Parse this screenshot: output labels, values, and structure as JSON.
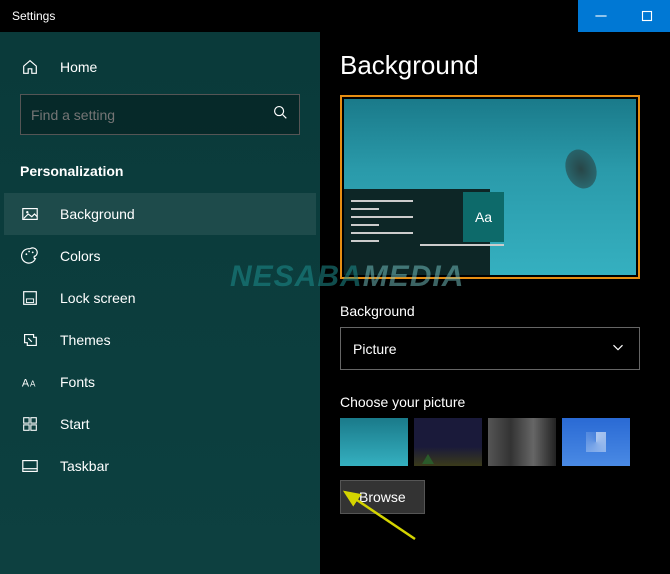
{
  "titlebar": {
    "title": "Settings"
  },
  "sidebar": {
    "home_label": "Home",
    "search_placeholder": "Find a setting",
    "section_header": "Personalization",
    "items": [
      {
        "label": "Background"
      },
      {
        "label": "Colors"
      },
      {
        "label": "Lock screen"
      },
      {
        "label": "Themes"
      },
      {
        "label": "Fonts"
      },
      {
        "label": "Start"
      },
      {
        "label": "Taskbar"
      }
    ]
  },
  "content": {
    "page_title": "Background",
    "preview_sample_text": "Aa",
    "dropdown_label": "Background",
    "dropdown_value": "Picture",
    "choose_label": "Choose your picture",
    "browse_label": "Browse"
  },
  "watermark": {
    "part1": "NESABA",
    "part2": "MEDIA"
  }
}
